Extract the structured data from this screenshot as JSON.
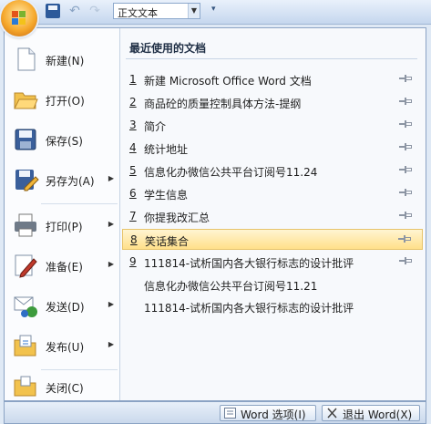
{
  "quick_access": {
    "style_value": "正文文本",
    "more_label": "▾"
  },
  "menu": {
    "commands": [
      {
        "label": "新建(N)",
        "icon": "new-document-icon",
        "has_submenu": false
      },
      {
        "label": "打开(O)",
        "icon": "open-folder-icon",
        "has_submenu": false
      },
      {
        "label": "保存(S)",
        "icon": "save-disk-icon",
        "has_submenu": false
      },
      {
        "label": "另存为(A)",
        "icon": "save-as-icon",
        "has_submenu": true
      },
      {
        "label": "打印(P)",
        "icon": "printer-icon",
        "has_submenu": true
      },
      {
        "label": "准备(E)",
        "icon": "prepare-pen-icon",
        "has_submenu": true
      },
      {
        "label": "发送(D)",
        "icon": "send-icon",
        "has_submenu": true
      },
      {
        "label": "发布(U)",
        "icon": "publish-icon",
        "has_submenu": true
      },
      {
        "label": "关闭(C)",
        "icon": "close-folder-icon",
        "has_submenu": false
      }
    ],
    "recent_title": "最近使用的文档",
    "recent": [
      {
        "num": "1",
        "name": "新建 Microsoft Office Word 文档"
      },
      {
        "num": "2",
        "name": "商品砼的质量控制具体方法-提纲"
      },
      {
        "num": "3",
        "name": "简介"
      },
      {
        "num": "4",
        "name": "统计地址"
      },
      {
        "num": "5",
        "name": "信息化办微信公共平台订阅号11.24"
      },
      {
        "num": "6",
        "name": "学生信息"
      },
      {
        "num": "7",
        "name": "你提我改汇总"
      },
      {
        "num": "8",
        "name": "笑话集合",
        "highlighted": true
      },
      {
        "num": "9",
        "name": "111814-试析国内各大银行标志的设计批评"
      },
      {
        "num": "",
        "name": "信息化办微信公共平台订阅号11.21"
      },
      {
        "num": "",
        "name": "111814-试析国内各大银行标志的设计批评"
      }
    ]
  },
  "footer": {
    "options_label": "Word 选项(I)",
    "exit_label": "退出 Word(X)"
  },
  "colors": {
    "highlight": "#ffe08a",
    "office_orange": "#f6a92d",
    "menu_border": "#8ba3c4"
  }
}
